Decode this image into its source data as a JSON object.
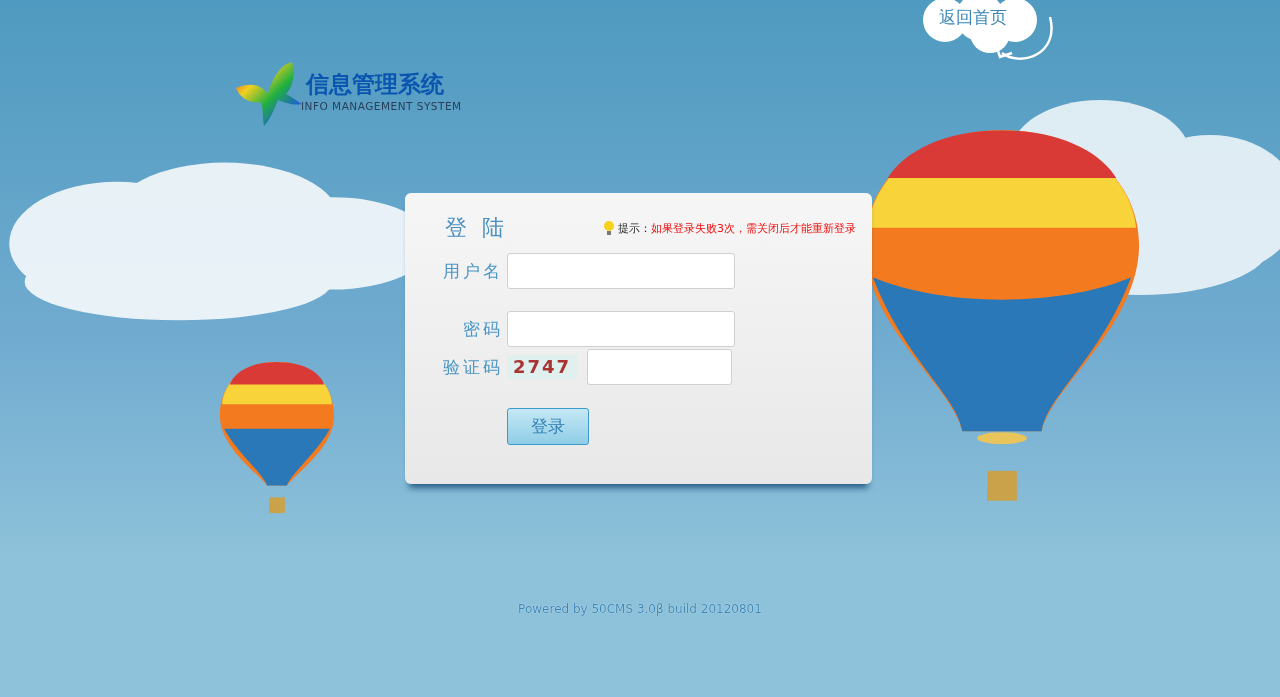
{
  "home_link": {
    "label": "返回首页"
  },
  "logo": {
    "title": "信息管理系统",
    "subtitle": "INFO MANAGEMENT SYSTEM"
  },
  "login": {
    "title": "登 陆",
    "hint": {
      "label": "提示：",
      "message": "如果登录失败3次，需关闭后才能重新登录"
    },
    "fields": [
      {
        "label": "用户名",
        "kind": "text"
      },
      {
        "label": "密码",
        "kind": "password"
      },
      {
        "label": "验证码",
        "kind": "captcha",
        "captcha": "2747"
      }
    ],
    "submit": "登录"
  },
  "footer": "Powered by 50CMS 3.0β build 20120801"
}
